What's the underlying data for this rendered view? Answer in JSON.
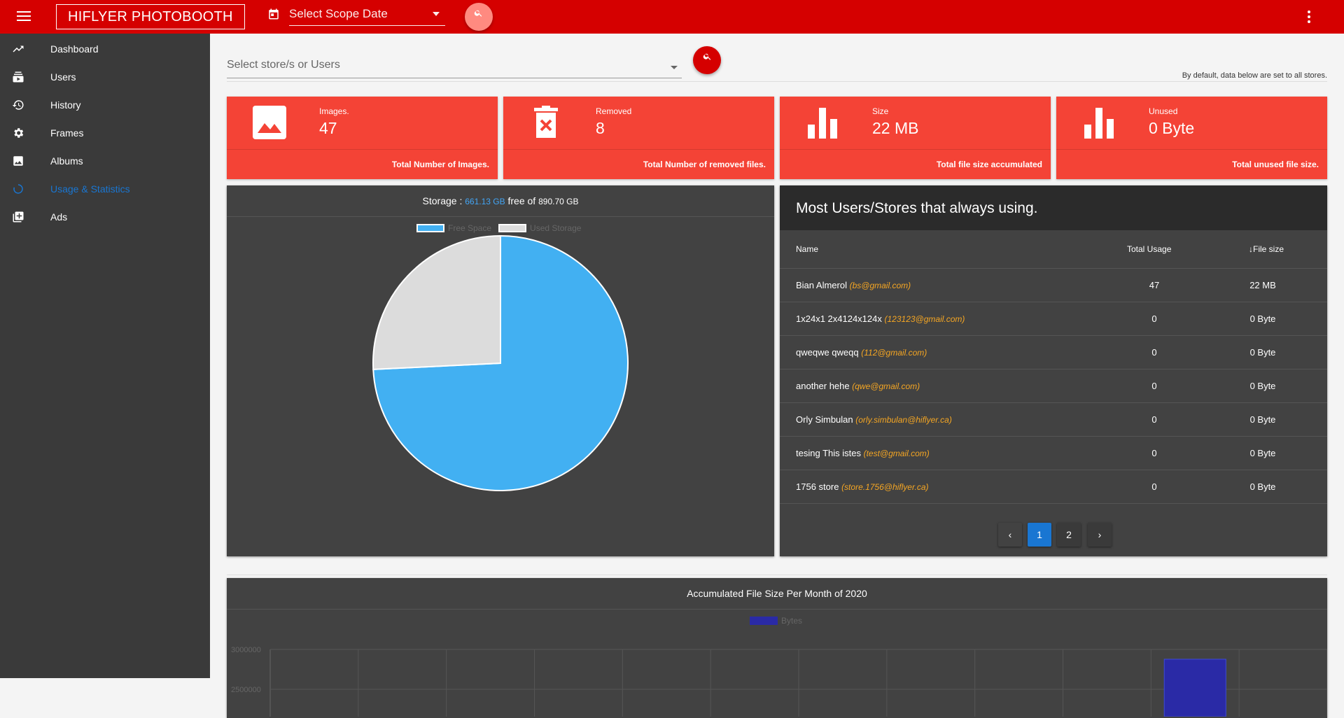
{
  "header": {
    "brand": "HIFLYER PHOTOBOOTH",
    "scope_placeholder": "Select Scope Date",
    "icons": [
      "menu-icon",
      "calendar-icon",
      "search-icon",
      "more-vert-icon"
    ]
  },
  "sidebar": {
    "items": [
      {
        "label": "Dashboard",
        "icon": "trending-up-icon",
        "active": false
      },
      {
        "label": "Users",
        "icon": "subscriptions-icon",
        "active": false
      },
      {
        "label": "History",
        "icon": "history-icon",
        "active": false
      },
      {
        "label": "Frames",
        "icon": "gear-icon",
        "active": false
      },
      {
        "label": "Albums",
        "icon": "image-icon",
        "active": false
      },
      {
        "label": "Usage & Statistics",
        "icon": "loading-circle-icon",
        "active": true
      },
      {
        "label": "Ads",
        "icon": "library-icon",
        "active": false
      }
    ]
  },
  "filter": {
    "store_placeholder": "Select store/s or Users",
    "default_note": "By default, data below are set to all stores."
  },
  "cards": [
    {
      "title": "Images.",
      "value": "47",
      "footer": "Total Number of Images.",
      "icon": "image-icon"
    },
    {
      "title": "Removed",
      "value": "8",
      "footer": "Total Number of removed files.",
      "icon": "trash-icon"
    },
    {
      "title": "Size",
      "value": "22 MB",
      "footer": "Total file size accumulated",
      "icon": "bar-chart-icon"
    },
    {
      "title": "Unused",
      "value": "0 Byte",
      "footer": "Total unused file size.",
      "icon": "bar-chart-icon"
    }
  ],
  "storage": {
    "prefix": "Storage :",
    "free": "661.13 GB",
    "mid": "free of",
    "total": "890.70 GB",
    "legend": [
      {
        "label": "Free Space",
        "color": "#42b0f2"
      },
      {
        "label": "Used Storage",
        "color": "#dcdcdc"
      }
    ]
  },
  "users_table": {
    "title": "Most Users/Stores that always using.",
    "headers": {
      "name": "Name",
      "usage": "Total Usage",
      "size": "File size"
    },
    "rows": [
      {
        "name": "Bian Almerol",
        "email": "(bs@gmail.com)",
        "usage": "47",
        "size": "22 MB"
      },
      {
        "name": "1x24x1 2x4124x124x",
        "email": "(123123@gmail.com)",
        "usage": "0",
        "size": "0 Byte"
      },
      {
        "name": "qweqwe qweqq",
        "email": "(112@gmail.com)",
        "usage": "0",
        "size": "0 Byte"
      },
      {
        "name": "another hehe",
        "email": "(qwe@gmail.com)",
        "usage": "0",
        "size": "0 Byte"
      },
      {
        "name": "Orly Simbulan",
        "email": "(orly.simbulan@hiflyer.ca)",
        "usage": "0",
        "size": "0 Byte"
      },
      {
        "name": "tesing This istes",
        "email": "(test@gmail.com)",
        "usage": "0",
        "size": "0 Byte"
      },
      {
        "name": "1756 store",
        "email": "(store.1756@hiflyer.ca)",
        "usage": "0",
        "size": "0 Byte"
      }
    ],
    "pagination": {
      "pages": [
        "1",
        "2"
      ],
      "current": "1"
    }
  },
  "chart_data": [
    {
      "type": "pie",
      "title": "",
      "labels": [
        "Free Space",
        "Used Storage"
      ],
      "values": [
        661.13,
        229.57
      ],
      "colors": [
        "#42b0f2",
        "#dcdcdc"
      ],
      "legend_position": "top"
    },
    {
      "type": "bar",
      "title": "Accumulated File Size Per Month of 2020",
      "series": [
        {
          "name": "Bytes",
          "color": "#2a2aa6"
        }
      ],
      "y_ticks": [
        "3000000",
        "2500000"
      ]
    }
  ]
}
